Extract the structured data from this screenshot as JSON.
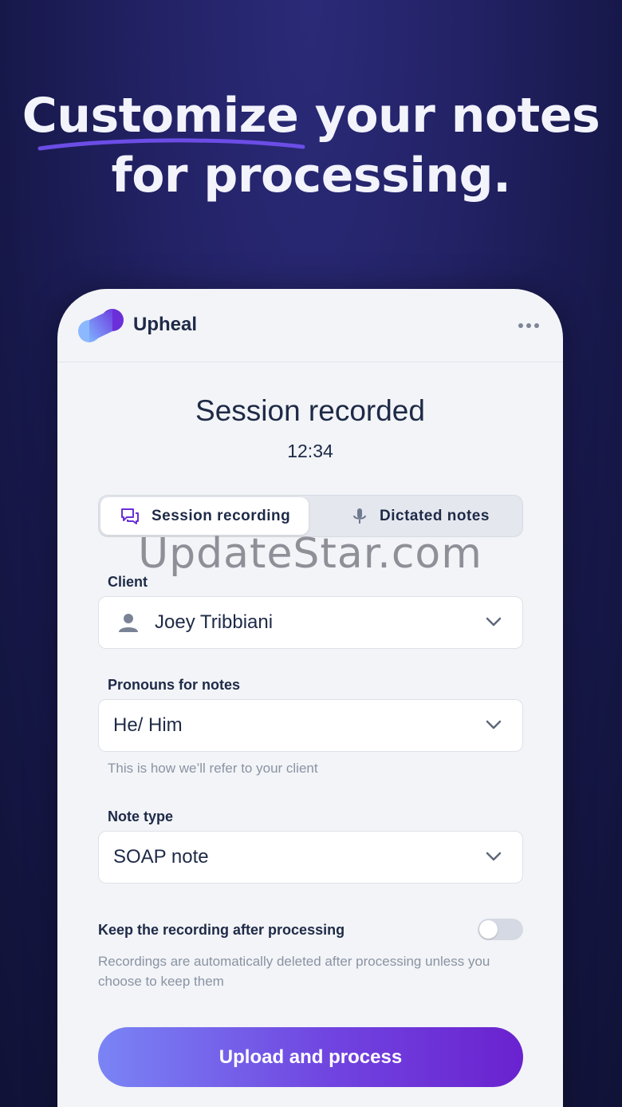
{
  "headline": {
    "emphasis": "Customize",
    "line1_rest": " your notes",
    "line2": "for processing."
  },
  "app": {
    "brand": "Upheal",
    "menu_icon": "more-horizontal-icon"
  },
  "session": {
    "title": "Session recorded",
    "time": "12:34"
  },
  "tabs": [
    {
      "label": "Session recording",
      "icon": "chat-bubbles-icon",
      "active": true
    },
    {
      "label": "Dictated notes",
      "icon": "microphone-icon",
      "active": false
    }
  ],
  "watermark": "UpdateStar.com",
  "client": {
    "label": "Client",
    "value": "Joey Tribbiani"
  },
  "pronouns": {
    "label": "Pronouns for notes",
    "value": "He/ Him",
    "hint": "This is how we’ll refer to your client"
  },
  "note_type": {
    "label": "Note type",
    "value": "SOAP note"
  },
  "keep_recording": {
    "label": "Keep the recording after processing",
    "hint": "Recordings are automatically deleted after processing unless you choose to keep them",
    "enabled": false
  },
  "cta": {
    "label": "Upload and process"
  },
  "colors": {
    "background": "#232266",
    "accent": "#6a22cf",
    "text": "#1e2a47"
  }
}
